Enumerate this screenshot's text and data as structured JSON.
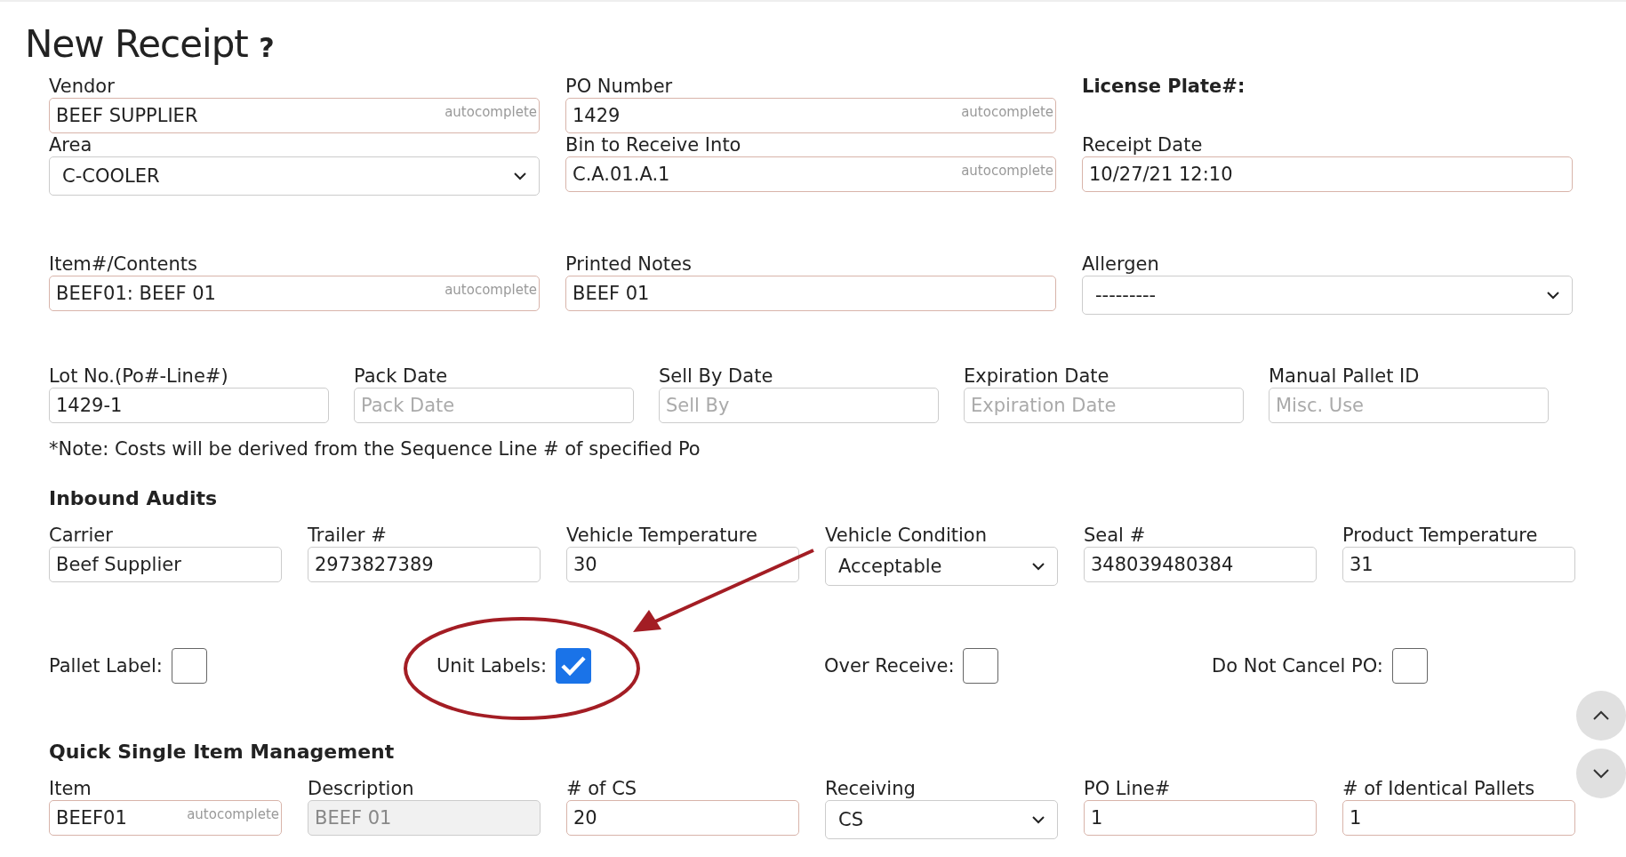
{
  "title": "New Receipt",
  "help_icon": "?",
  "main_fields": [
    {
      "kind": "text",
      "label": "Vendor",
      "value": "BEEF SUPPLIER",
      "hint": "autocomplete",
      "required": true
    },
    {
      "kind": "text",
      "label": "PO Number",
      "value": "1429",
      "hint": "autocomplete",
      "required": true
    },
    {
      "kind": "heading",
      "label": "License Plate#:"
    },
    {
      "kind": "select",
      "label": "Area",
      "value": "C-COOLER",
      "required": false
    },
    {
      "kind": "text",
      "label": "Bin to Receive Into",
      "value": "C.A.01.A.1",
      "hint": "autocomplete",
      "required": true
    },
    {
      "kind": "text",
      "label": "Receipt Date",
      "value": "10/27/21 12:10",
      "required": true
    },
    {
      "kind": "text",
      "label": "Item#/Contents",
      "value": "BEEF01: BEEF 01",
      "hint": "autocomplete",
      "required": true
    },
    {
      "kind": "text",
      "label": "Printed Notes",
      "value": "BEEF 01",
      "required": true
    },
    {
      "kind": "select",
      "label": "Allergen",
      "value": "---------",
      "required": false
    }
  ],
  "date_fields": [
    {
      "kind": "text",
      "label": "Lot No.(Po#-Line#)",
      "value": "1429-1",
      "required": false
    },
    {
      "kind": "text",
      "label": "Pack Date",
      "placeholder": "Pack Date",
      "required": false
    },
    {
      "kind": "text",
      "label": "Sell By Date",
      "placeholder": "Sell By",
      "required": false
    },
    {
      "kind": "text",
      "label": "Expiration Date",
      "placeholder": "Expiration Date",
      "required": false
    },
    {
      "kind": "text",
      "label": "Manual Pallet ID",
      "placeholder": "Misc. Use",
      "required": false
    }
  ],
  "note": "*Note: Costs will be derived from the Sequence Line # of specified Po",
  "inbound_audits": {
    "heading": "Inbound Audits",
    "fields": [
      {
        "kind": "text",
        "label": "Carrier",
        "value": "Beef Supplier",
        "required": false
      },
      {
        "kind": "text",
        "label": "Trailer #",
        "value": "2973827389",
        "required": false
      },
      {
        "kind": "text",
        "label": "Vehicle Temperature",
        "value": "30",
        "required": false
      },
      {
        "kind": "select",
        "label": "Vehicle Condition",
        "value": "Acceptable",
        "required": false
      },
      {
        "kind": "text",
        "label": "Seal #",
        "value": "348039480384",
        "required": false
      },
      {
        "kind": "text",
        "label": "Product Temperature",
        "value": "31",
        "required": false
      }
    ]
  },
  "options": [
    {
      "label": "Pallet Label:",
      "checked": false
    },
    {
      "label": "Unit Labels:",
      "checked": true
    },
    {
      "label": "Over Receive:",
      "checked": false
    },
    {
      "label": "Do Not Cancel PO:",
      "checked": false
    }
  ],
  "quick_item": {
    "heading": "Quick Single Item Management",
    "fields": [
      {
        "kind": "text",
        "label": "Item",
        "value": "BEEF01",
        "hint": "autocomplete",
        "required": true
      },
      {
        "kind": "text",
        "label": "Description",
        "value": "BEEF 01",
        "required": false,
        "disabled": true
      },
      {
        "kind": "text",
        "label": "# of CS",
        "value": "20",
        "required": true
      },
      {
        "kind": "select",
        "label": "Receiving",
        "value": "CS",
        "required": false
      },
      {
        "kind": "text",
        "label": "PO Line#",
        "value": "1",
        "required": true
      },
      {
        "kind": "text",
        "label": "# of Identical Pallets",
        "value": "1",
        "required": true
      }
    ]
  }
}
